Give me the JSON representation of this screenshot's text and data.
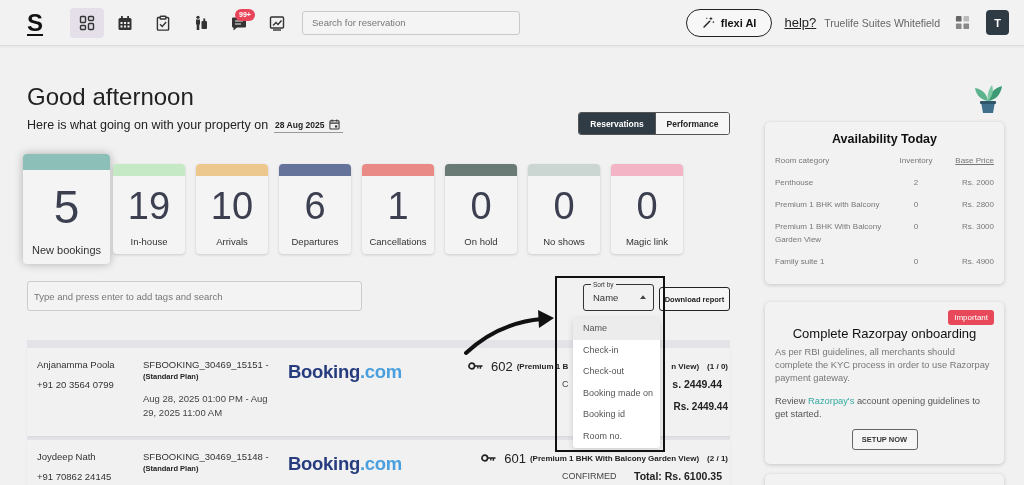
{
  "topbar": {
    "logo": "S",
    "nav": [
      {
        "selected": true
      },
      {
        "selected": false
      },
      {
        "selected": false
      },
      {
        "selected": false
      },
      {
        "selected": false,
        "badge": "99+"
      },
      {
        "selected": false
      }
    ],
    "search": {
      "placeholder": "Search for reservation"
    },
    "ai_button": "flexi AI",
    "help_link": "help?",
    "property_name": "Truelife Suites Whitefield",
    "avatar": "T"
  },
  "greeting": "Good afternoon",
  "subtitle": "Here is what going on with your property on",
  "date": "28 Aug 2025",
  "view_tabs": [
    {
      "label": "Reservations",
      "selected": true
    },
    {
      "label": "Performance",
      "selected": false
    }
  ],
  "stats": [
    {
      "value": "5",
      "label": "New bookings",
      "color": "#8bbfb7",
      "selected": true
    },
    {
      "value": "19",
      "label": "In-house",
      "color": "#c5e8c5",
      "selected": false
    },
    {
      "value": "10",
      "label": "Arrivals",
      "color": "#ecc88e",
      "selected": false
    },
    {
      "value": "6",
      "label": "Departures",
      "color": "#65739a",
      "selected": false
    },
    {
      "value": "1",
      "label": "Cancellations",
      "color": "#e98a87",
      "selected": false
    },
    {
      "value": "0",
      "label": "On hold",
      "color": "#6a7a74",
      "selected": false
    },
    {
      "value": "0",
      "label": "No shows",
      "color": "#cbd6d2",
      "selected": false
    },
    {
      "value": "0",
      "label": "Magic link",
      "color": "#f3b5c5",
      "selected": false
    }
  ],
  "tag_search": {
    "placeholder": "Type and press enter to add tags and search"
  },
  "sort": {
    "legend": "Sort by",
    "value": "Name",
    "expanded": true,
    "options": [
      {
        "label": "Name",
        "selected": true
      },
      {
        "label": "Check-in",
        "selected": false
      },
      {
        "label": "Check-out",
        "selected": false
      },
      {
        "label": "Booking made on",
        "selected": false
      },
      {
        "label": "Booking id",
        "selected": false
      },
      {
        "label": "Room no.",
        "selected": false
      }
    ]
  },
  "download_button": "Download report",
  "bookings": [
    {
      "name": "Anjanamma Poola",
      "phone": "+91 20 3564 0799",
      "booking_id": "SFBOOKING_30469_15151 -",
      "plan": "(Standard Plan)",
      "dates": "Aug 28, 2025 01:00 PM - Aug 29, 2025 11:00 AM",
      "source": {
        "brand": "Booking",
        "domain": ".com"
      },
      "room": "602",
      "room_type": [
        "(Premium 1 B",
        "n View)"
      ],
      "occupancy": "(1 / 0)",
      "status": "C",
      "total": "s. 2449.44",
      "balance": "Rs. 2449.44"
    },
    {
      "name": "Joydeep Nath",
      "phone": "+91 70862 24145",
      "booking_id": "SFBOOKING_30469_15148 -",
      "plan": "(Standard Plan)",
      "source": {
        "brand": "Booking",
        "domain": ".com"
      },
      "room": "601",
      "room_type": [
        "(Premium 1 BHK With Balcony Garden View)"
      ],
      "occupancy": "(2 / 1)",
      "status": "CONFIRMED",
      "total": "Total: Rs. 6100.35"
    }
  ],
  "availability": {
    "title": "Availability Today",
    "columns": [
      "Room category",
      "Inventory",
      "Base Price"
    ],
    "rows": [
      [
        "Penthouse",
        "2",
        "Rs. 2000"
      ],
      [
        "Premium 1 BHK with Balcony",
        "0",
        "Rs. 2800"
      ],
      [
        "Premium 1 BHK With Balcony Garden View",
        "0",
        "Rs. 3000"
      ],
      [
        "Family suite 1",
        "0",
        "Rs. 4900"
      ]
    ]
  },
  "notice": {
    "badge": "Important",
    "title": "Complete Razorpay onboarding",
    "body": "As per RBI guidelines, all merchants should complete the KYC process in order to use Razorpay payment gateway.",
    "review": {
      "before": "Review ",
      "link": "Razorpay's",
      "after": " account opening guidelines to get started."
    },
    "button": "SETUP NOW"
  }
}
